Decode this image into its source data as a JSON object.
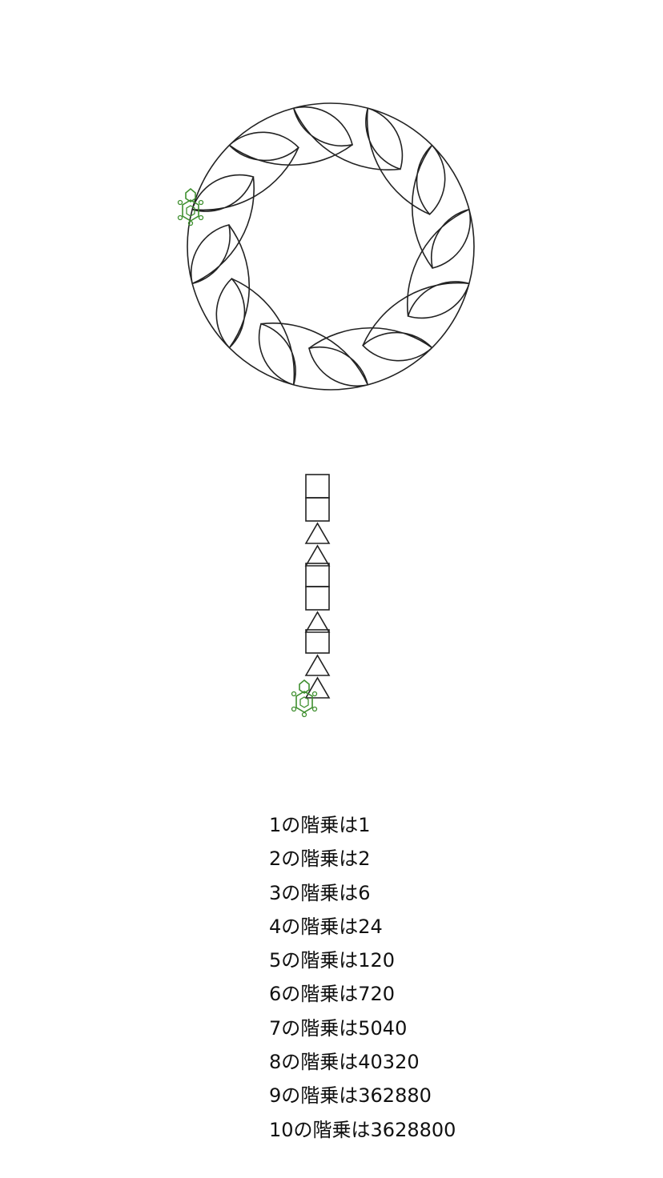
{
  "turtle_canvas": {
    "line_color": "#222222",
    "turtle_color": "#3f8f2f",
    "ring_petal_count": 12,
    "column_shapes": [
      "square",
      "square",
      "triangle",
      "triangle",
      "square",
      "square",
      "triangle",
      "square",
      "triangle",
      "triangle"
    ],
    "turtles": [
      "turtle-icon",
      "turtle-icon"
    ]
  },
  "output": {
    "lines": [
      "1の階乗は1",
      "2の階乗は2",
      "3の階乗は6",
      "4の階乗は24",
      "5の階乗は120",
      "6の階乗は720",
      "7の階乗は5040",
      "8の階乗は40320",
      "9の階乗は362880",
      "10の階乗は3628800"
    ]
  }
}
